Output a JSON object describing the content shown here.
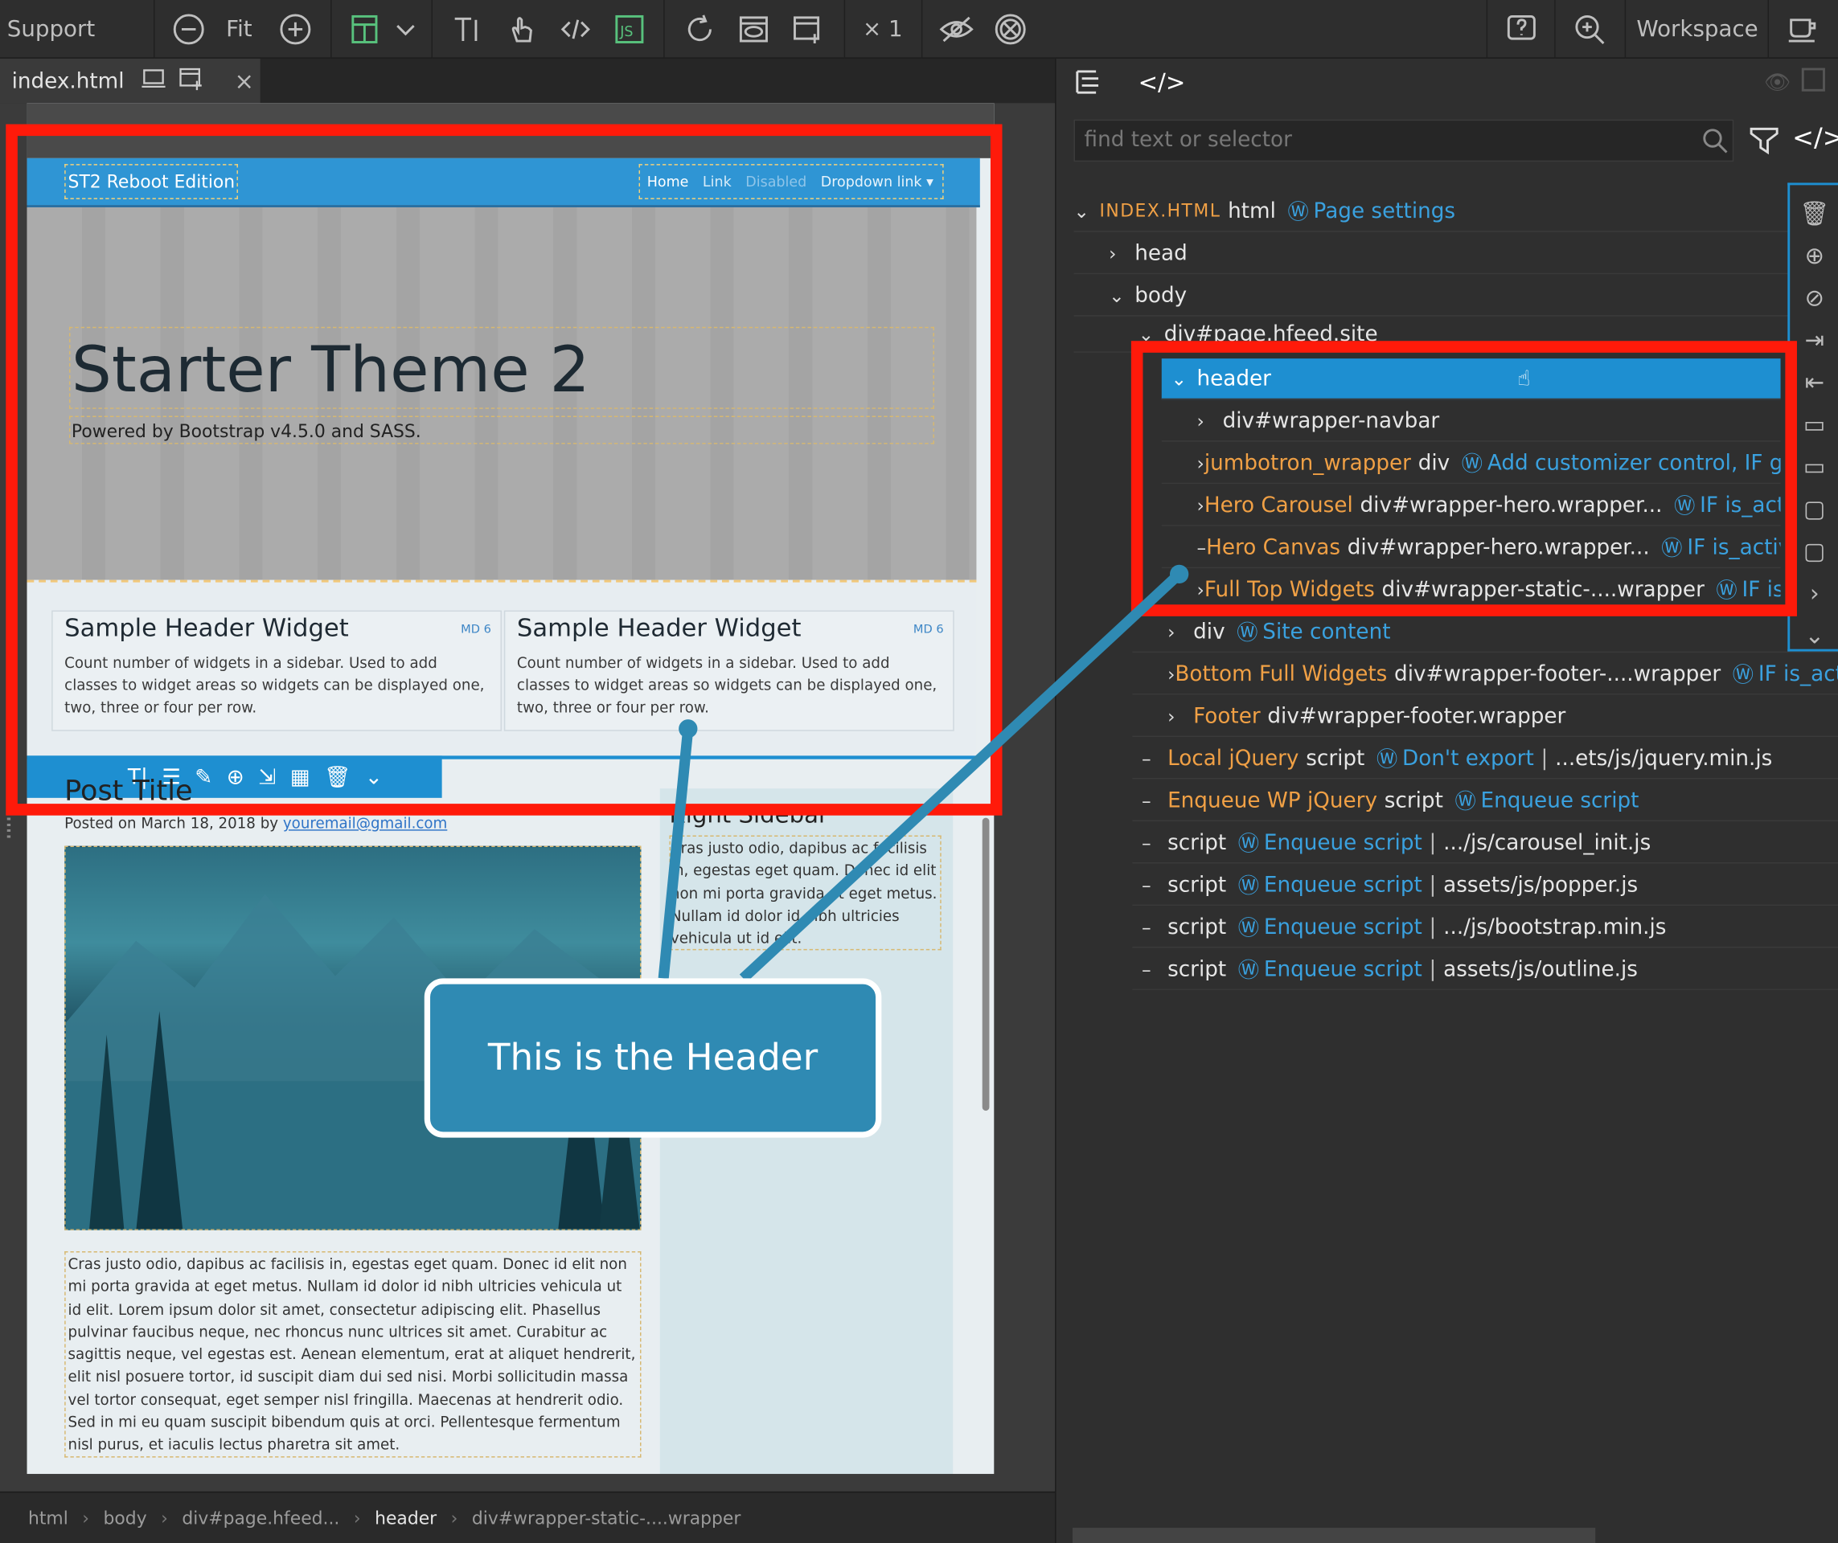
{
  "toolbar": {
    "support": "Support",
    "fit": "Fit",
    "multiplier": "× 1",
    "workspace": "Workspace"
  },
  "tab": {
    "filename": "index.html"
  },
  "page": {
    "brand": "ST2 Reboot Edition",
    "nav": [
      "Home",
      "Link",
      "Disabled",
      "Dropdown link"
    ],
    "hero_title": "Starter Theme 2",
    "hero_sub": "Powered by Bootstrap v4.5.0 and SASS.",
    "widgets": [
      {
        "title": "Sample Header Widget",
        "badge": "MD 6",
        "text": "Count number of widgets in a sidebar. Used to add classes to widget areas so widgets can be displayed one, two, three or four per row."
      },
      {
        "title": "Sample Header Widget",
        "badge": "MD 6",
        "text": "Count number of widgets in a sidebar. Used to add classes to widget areas so widgets can be displayed one, two, three or four per row."
      }
    ],
    "post_title": "Post Title",
    "posted_on": "Posted on",
    "post_date": "March 18, 2018",
    "post_by": "by",
    "post_email": "youremail@gmail.com",
    "post_body": "Cras justo odio, dapibus ac facilisis in, egestas eget quam. Donec id elit non mi porta gravida at eget metus. Nullam id dolor id nibh ultricies vehicula ut id elit. Lorem ipsum dolor sit amet, consectetur adipiscing elit. Phasellus pulvinar faucibus neque, nec rhoncus nunc ultrices sit amet. Curabitur ac sagittis neque, vel egestas est. Aenean elementum, erat at aliquet hendrerit, elit nisl posuere tortor, id suscipit diam dui sed nisi. Morbi sollicitudin massa vel tortor consequat, eget semper nisl fringilla. Maecenas at hendrerit odio. Sed in mi eu quam suscipit bibendum quis at orci. Pellentesque fermentum nisl purus, et iaculis lectus pharetra sit amet.",
    "sidebar_title": "Right Sidebar",
    "sidebar_body": "Cras justo odio, dapibus ac facilisis in, egestas eget quam. Donec id elit non mi porta gravida at eget metus. Nullam id dolor id nibh ultricies vehicula ut id elit."
  },
  "callout": "This is the Header",
  "breadcrumbs": [
    "html",
    "body",
    "div#page.hfeed...",
    "header",
    "div#wrapper-static-....wrapper"
  ],
  "panel": {
    "search_placeholder": "find text or selector",
    "tree": {
      "root_label": "INDEX.HTML",
      "root_tag": "html",
      "root_wp": "Page settings",
      "head": "head",
      "body": "body",
      "page_div": "div#page.hfeed.site",
      "header": "header",
      "navbar": "div#wrapper-navbar",
      "jumbo_name": "jumbotron_wrapper",
      "jumbo_tag": "div",
      "jumbo_wp": "Add customizer control, IF get",
      "hero_carousel_name": "Hero Carousel",
      "hero_carousel_tag": "div#wrapper-hero.wrapper...",
      "hero_carousel_wp": "IF is_activ",
      "hero_canvas_name": "Hero Canvas",
      "hero_canvas_tag": "div#wrapper-hero.wrapper...",
      "hero_canvas_wp": "IF is_active_",
      "full_top_name": "Full Top Widgets",
      "full_top_tag": "div#wrapper-static-....wrapper",
      "full_top_wp": "IF is_a",
      "div_tag": "div",
      "div_wp": "Site content",
      "bottom_name": "Bottom Full Widgets",
      "bottom_tag": "div#wrapper-footer-....wrapper",
      "bottom_wp": "IF is_active",
      "footer_name": "Footer",
      "footer_tag": "div#wrapper-footer.wrapper",
      "scripts": [
        {
          "name": "Local jQuery",
          "tag": "script",
          "wp": "Don't export",
          "path": "...ets/js/jquery.min.js"
        },
        {
          "name": "Enqueue WP jQuery",
          "tag": "script",
          "wp": "Enqueue script",
          "path": ""
        },
        {
          "name": "",
          "tag": "script",
          "wp": "Enqueue script",
          "path": ".../js/carousel_init.js"
        },
        {
          "name": "",
          "tag": "script",
          "wp": "Enqueue script",
          "path": "assets/js/popper.js"
        },
        {
          "name": "",
          "tag": "script",
          "wp": "Enqueue script",
          "path": ".../js/bootstrap.min.js"
        },
        {
          "name": "",
          "tag": "script",
          "wp": "Enqueue script",
          "path": "assets/js/outline.js"
        }
      ]
    }
  },
  "colors": {
    "accent": "#1e8fd1",
    "highlight": "#ff1a0a",
    "callout": "#2f8ab3",
    "orange": "#f0a045"
  }
}
